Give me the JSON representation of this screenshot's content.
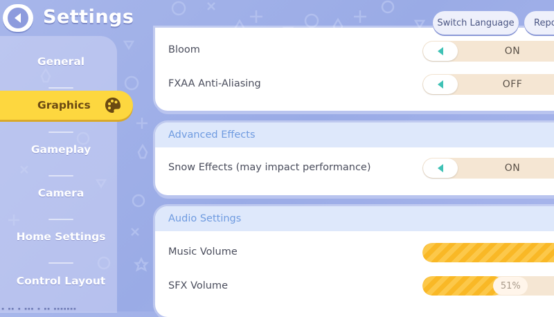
{
  "header": {
    "title": "Settings",
    "switch_language_label": "Switch Language",
    "report_label": "Report"
  },
  "sidebar": {
    "items": [
      {
        "label": "General",
        "active": false
      },
      {
        "label": "Graphics",
        "active": true
      },
      {
        "label": "Gameplay",
        "active": false
      },
      {
        "label": "Camera",
        "active": false
      },
      {
        "label": "Home Settings",
        "active": false
      },
      {
        "label": "Control Layout",
        "active": false
      }
    ]
  },
  "graphics": {
    "bloom": {
      "label": "Bloom",
      "value": "ON"
    },
    "fxaa": {
      "label": "FXAA Anti-Aliasing",
      "value": "OFF"
    }
  },
  "advanced_effects": {
    "title": "Advanced Effects",
    "snow": {
      "label": "Snow Effects (may impact performance)",
      "value": "ON"
    }
  },
  "audio": {
    "title": "Audio Settings",
    "music": {
      "label": "Music Volume",
      "level_percent": 100
    },
    "sfx": {
      "label": "SFX Volume",
      "level_percent": 51,
      "display": "51%"
    }
  },
  "colors": {
    "accent_yellow": "#fdd73f",
    "toggle_arrow": "#3fc1b5",
    "slider_fill": "#f9b826",
    "header_text": "#6f9be0"
  }
}
